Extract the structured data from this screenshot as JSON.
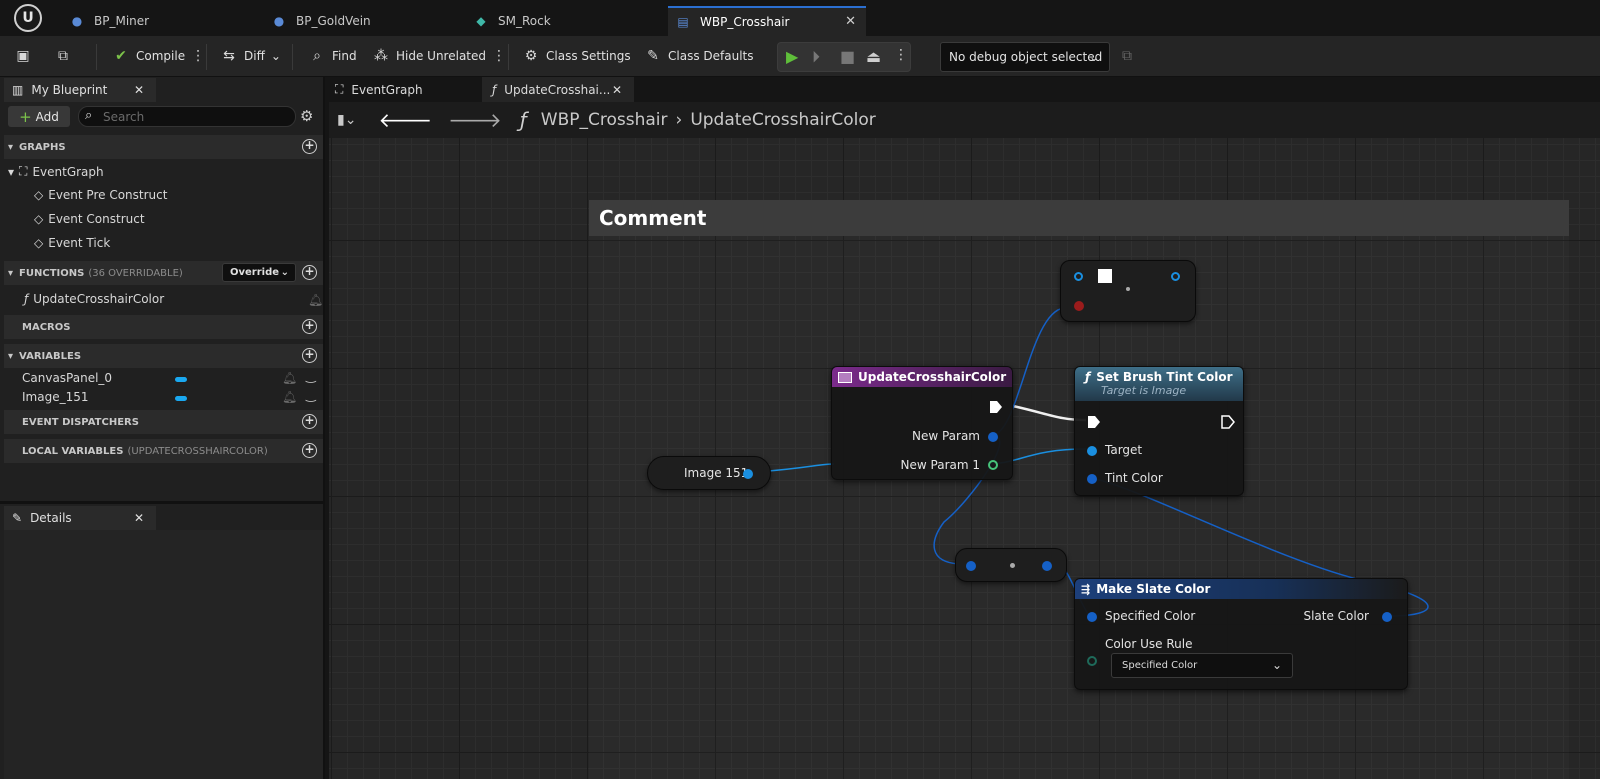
{
  "tabs": [
    {
      "label": "BP_Miner",
      "icon": "blueprint-actor-icon"
    },
    {
      "label": "BP_GoldVein",
      "icon": "blueprint-actor-icon"
    },
    {
      "label": "SM_Rock",
      "icon": "static-mesh-icon"
    },
    {
      "label": "WBP_Crosshair",
      "icon": "widget-blueprint-icon",
      "active": true
    }
  ],
  "toolbar": {
    "compile": "Compile",
    "diff": "Diff",
    "find": "Find",
    "hide_unrelated": "Hide Unrelated",
    "class_settings": "Class Settings",
    "class_defaults": "Class Defaults",
    "debug_object": "No debug object selected"
  },
  "my_blueprint": {
    "tab_label": "My Blueprint",
    "add_label": "Add",
    "search_placeholder": "Search",
    "graphs_header": "GRAPHS",
    "event_graph": "EventGraph",
    "events": [
      "Event Pre Construct",
      "Event Construct",
      "Event Tick"
    ],
    "functions_header": "FUNCTIONS",
    "functions_sub": "(36 OVERRIDABLE)",
    "override_label": "Override",
    "function_item": "UpdateCrosshairColor",
    "macros_header": "MACROS",
    "variables_header": "VARIABLES",
    "variables": [
      "CanvasPanel_0",
      "Image_151"
    ],
    "dispatchers_header": "EVENT DISPATCHERS",
    "local_vars_header": "LOCAL VARIABLES",
    "local_vars_sub": "(UPDATECROSSHAIRCOLOR)"
  },
  "details": {
    "tab_label": "Details"
  },
  "graph": {
    "tabs": [
      "EventGraph",
      "UpdateCrosshai..."
    ],
    "breadcrumb": [
      "WBP_Crosshair",
      "UpdateCrosshairColor"
    ],
    "comment": "Comment",
    "entry_node": {
      "title": "UpdateCrosshairColor",
      "pins": [
        "New Param",
        "New Param 1"
      ]
    },
    "image_var": "Image 151",
    "set_tint_node": {
      "title": "Set Brush Tint Color",
      "subtitle": "Target is Image",
      "pins": [
        "Target",
        "Tint Color"
      ]
    },
    "make_slate_node": {
      "title": "Make Slate Color",
      "pins": [
        "Specified Color",
        "Slate Color",
        "Color Use Rule"
      ],
      "rule_value": "Specified Color"
    }
  },
  "colors": {
    "accent": "#2b6fd1",
    "pin_object": "#1a8fe0",
    "pin_struct": "#0a4fbf",
    "function_header": "#7a2a8a",
    "pure_header": "#1d4c8a"
  }
}
